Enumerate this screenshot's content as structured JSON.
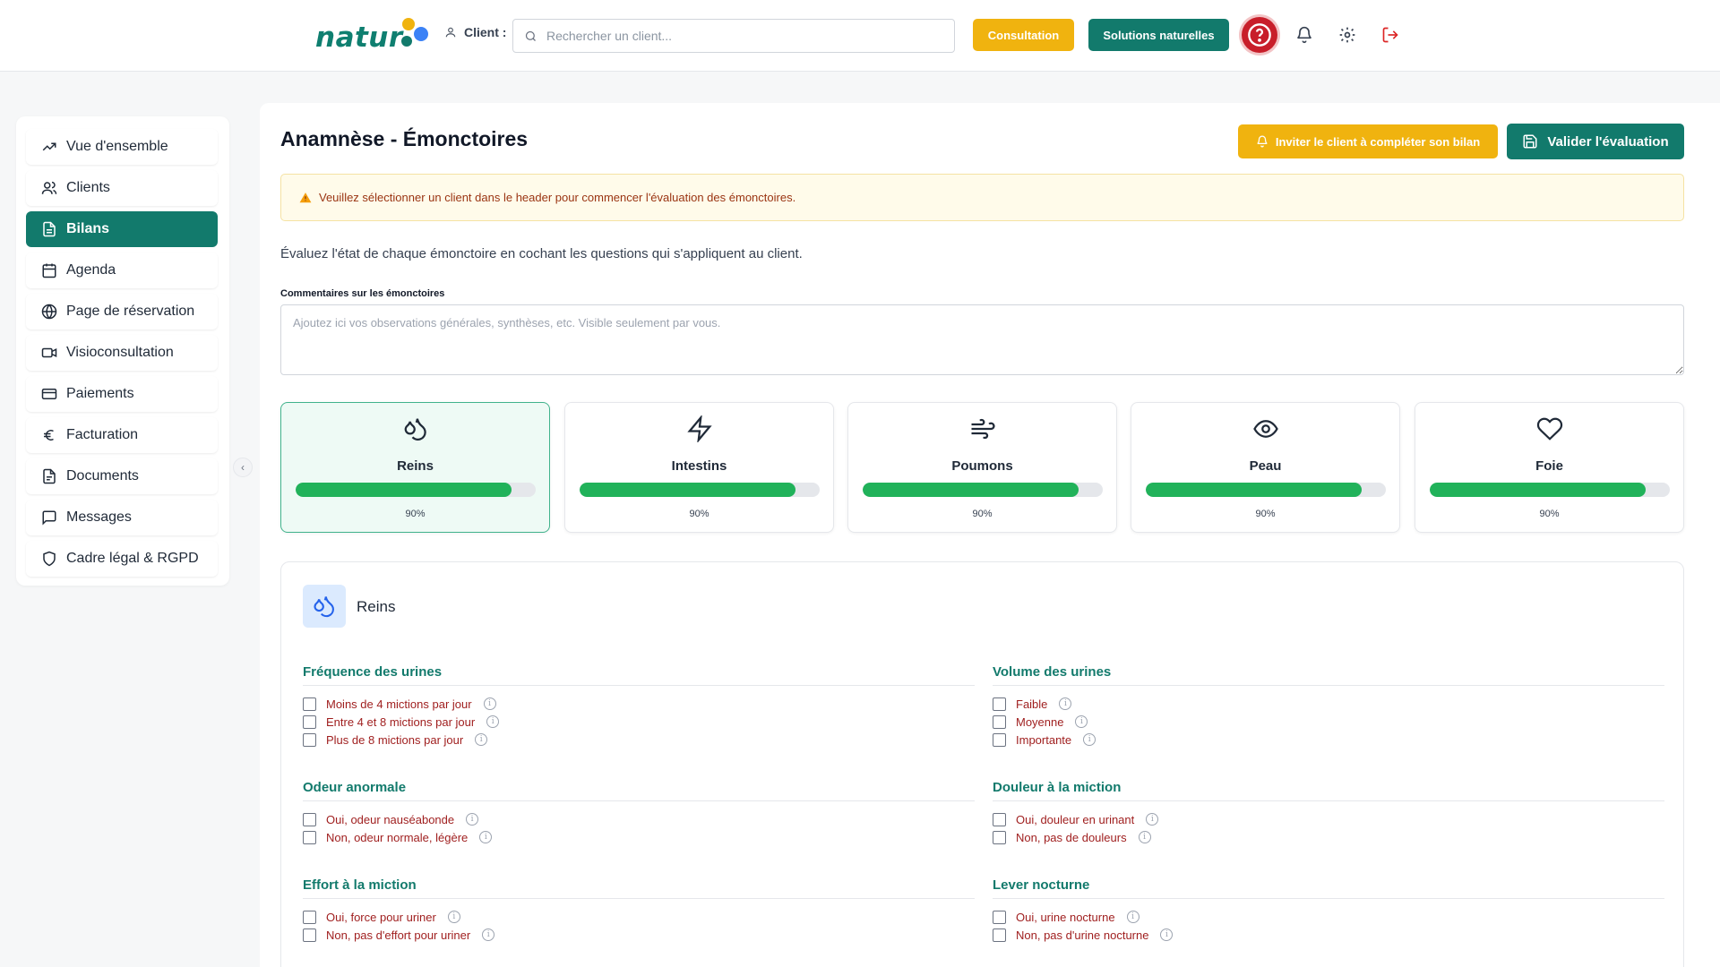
{
  "header": {
    "logo_text": "natur",
    "client_label": "Client :",
    "search_placeholder": "Rechercher un client...",
    "consultation_label": "Consultation",
    "solutions_label": "Solutions naturelles"
  },
  "sidebar": {
    "items": [
      {
        "label": "Vue d'ensemble",
        "icon": "trending-up-icon"
      },
      {
        "label": "Clients",
        "icon": "users-icon"
      },
      {
        "label": "Bilans",
        "icon": "document-icon",
        "active": true
      },
      {
        "label": "Agenda",
        "icon": "calendar-icon"
      },
      {
        "label": "Page de réservation",
        "icon": "globe-icon"
      },
      {
        "label": "Visioconsultation",
        "icon": "video-icon"
      },
      {
        "label": "Paiements",
        "icon": "credit-card-icon"
      },
      {
        "label": "Facturation",
        "icon": "euro-icon"
      },
      {
        "label": "Documents",
        "icon": "file-icon"
      },
      {
        "label": "Messages",
        "icon": "message-icon"
      },
      {
        "label": "Cadre légal & RGPD",
        "icon": "shield-icon"
      }
    ]
  },
  "main": {
    "title": "Anamnèse - Émonctoires",
    "invite_label": "Inviter le client à compléter son bilan",
    "validate_label": "Valider l'évaluation",
    "alert": "Veuillez sélectionner un client dans le header pour commencer l'évaluation des émonctoires.",
    "intro": "Évaluez l'état de chaque émonctoire en cochant les questions qui s'appliquent au client.",
    "comment_label": "Commentaires sur les émonctoires",
    "comment_placeholder": "Ajoutez ici vos observations générales, synthèses, etc. Visible seulement par vous."
  },
  "cards": [
    {
      "name": "Reins",
      "progress": 90,
      "pct_label": "90%",
      "icon": "droplets-icon",
      "active": true
    },
    {
      "name": "Intestins",
      "progress": 90,
      "pct_label": "90%",
      "icon": "lightning-icon"
    },
    {
      "name": "Poumons",
      "progress": 90,
      "pct_label": "90%",
      "icon": "wind-icon"
    },
    {
      "name": "Peau",
      "progress": 90,
      "pct_label": "90%",
      "icon": "eye-icon"
    },
    {
      "name": "Foie",
      "progress": 90,
      "pct_label": "90%",
      "icon": "heart-icon"
    }
  ],
  "section": {
    "title": "Reins",
    "groups": [
      {
        "title": "Fréquence des urines",
        "options": [
          "Moins de 4 mictions par jour",
          "Entre 4 et 8 mictions par jour",
          "Plus de 8 mictions par jour"
        ]
      },
      {
        "title": "Volume des urines",
        "options": [
          "Faible",
          "Moyenne",
          "Importante"
        ]
      },
      {
        "title": "Odeur anormale",
        "options": [
          "Oui, odeur nauséabonde",
          "Non, odeur normale, légère"
        ]
      },
      {
        "title": "Douleur à la miction",
        "options": [
          "Oui, douleur en urinant",
          "Non, pas de douleurs"
        ]
      },
      {
        "title": "Effort à la miction",
        "options": [
          "Oui, force pour uriner",
          "Non, pas d'effort pour uriner"
        ]
      },
      {
        "title": "Lever nocturne",
        "options": [
          "Oui, urine nocturne",
          "Non, pas d'urine nocturne"
        ]
      }
    ]
  },
  "colors": {
    "brand_teal": "#127a6c",
    "accent_yellow": "#f0b30f",
    "progress_green": "#21b25a",
    "option_red": "#9f1d1d"
  }
}
